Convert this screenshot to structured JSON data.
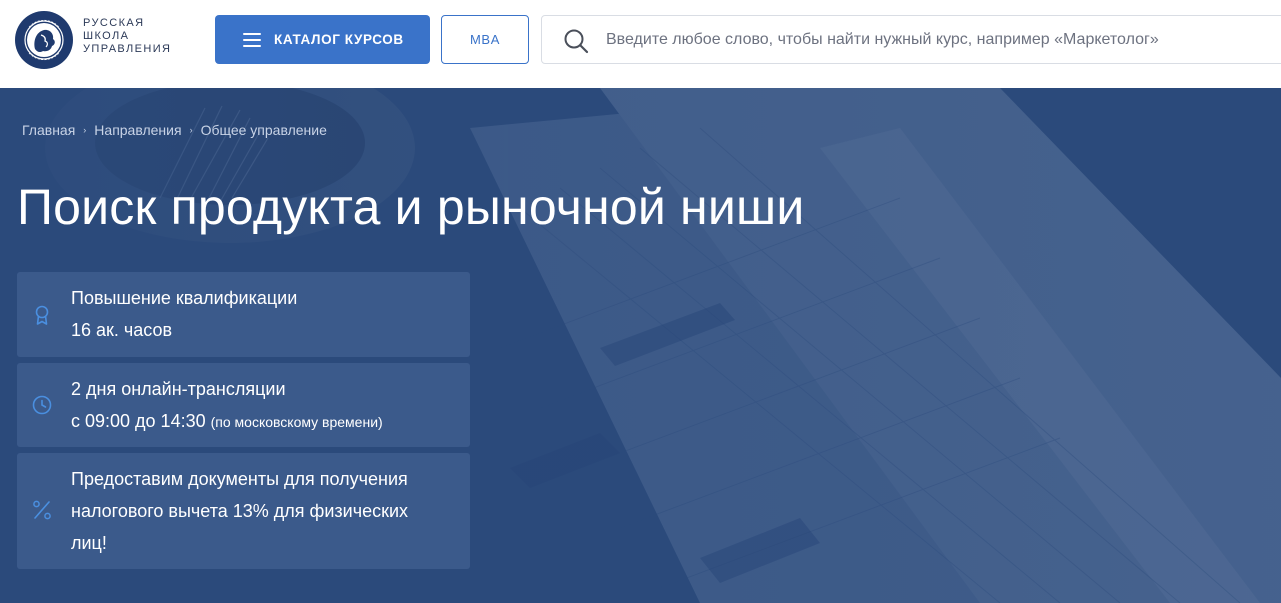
{
  "header": {
    "brand_lines": [
      "РУССКАЯ",
      "ШКОЛА",
      "УПРАВЛЕНИЯ"
    ],
    "logo_ring_text": "РУССКАЯ ШКОЛА УПРАВЛЕНИЯ",
    "catalog_label": "КАТАЛОГ КУРСОВ",
    "mba_label": "MBA",
    "search_placeholder": "Введите любое слово, чтобы найти нужный курс, например «Маркетолог»"
  },
  "breadcrumb": [
    "Главная",
    "Направления",
    "Общее управление"
  ],
  "page_title": "Поиск продукта и рыночной ниши",
  "cards": [
    {
      "icon": "award-icon",
      "line1": "Повышение квалификации",
      "line2": "16 ак. часов"
    },
    {
      "icon": "clock-icon",
      "line1": "2 дня онлайн-трансляции",
      "line2": "с 09:00 до 14:30",
      "line2_note": "(по московскому времени)"
    },
    {
      "icon": "percent-icon",
      "line1": "Предоставим документы для получения",
      "line2": "налогового вычета 13% для физических",
      "line3": "лиц!"
    }
  ],
  "colors": {
    "accent": "#3a73c9",
    "hero_bg": "#2b4a7c",
    "card_icon": "#4a8fe0"
  }
}
